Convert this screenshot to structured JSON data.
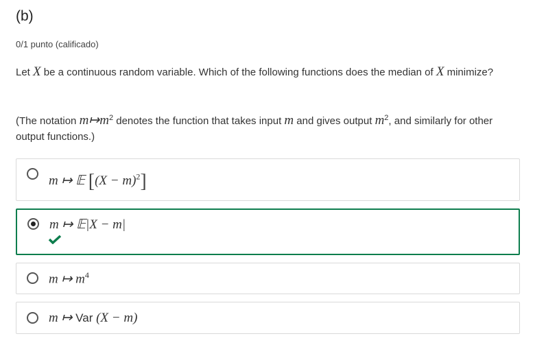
{
  "problem": {
    "title": "(b)",
    "points": "0/1 punto (calificado)",
    "question_pre": "Let ",
    "question_var": "X",
    "question_mid": " be a continuous random variable. Which of the following functions does the median of ",
    "question_var2": "X",
    "question_end": " minimize?",
    "note_pre": "(The notation ",
    "note_map": "m↦m",
    "note_sup": "2",
    "note_mid": " denotes the function that takes input ",
    "note_m": "m",
    "note_mid2": " and gives output ",
    "note_m2": "m",
    "note_sup2": "2",
    "note_end": ", and similarly for other output functions.)"
  },
  "options": [
    {
      "prefix": "m ↦ 𝔼",
      "lb": "[",
      "body": "(X − m)",
      "sup": "2",
      "rb": "]",
      "selected": false
    },
    {
      "prefix": "m ↦ 𝔼|X − m|",
      "selected": true,
      "status": "correct"
    },
    {
      "prefix": "m ↦ m",
      "sup": "4",
      "selected": false
    },
    {
      "prefix": "m ↦ ",
      "fn": "Var",
      "body": " (X − m)",
      "selected": false
    }
  ],
  "colors": {
    "correct": "#0d7d4d"
  }
}
